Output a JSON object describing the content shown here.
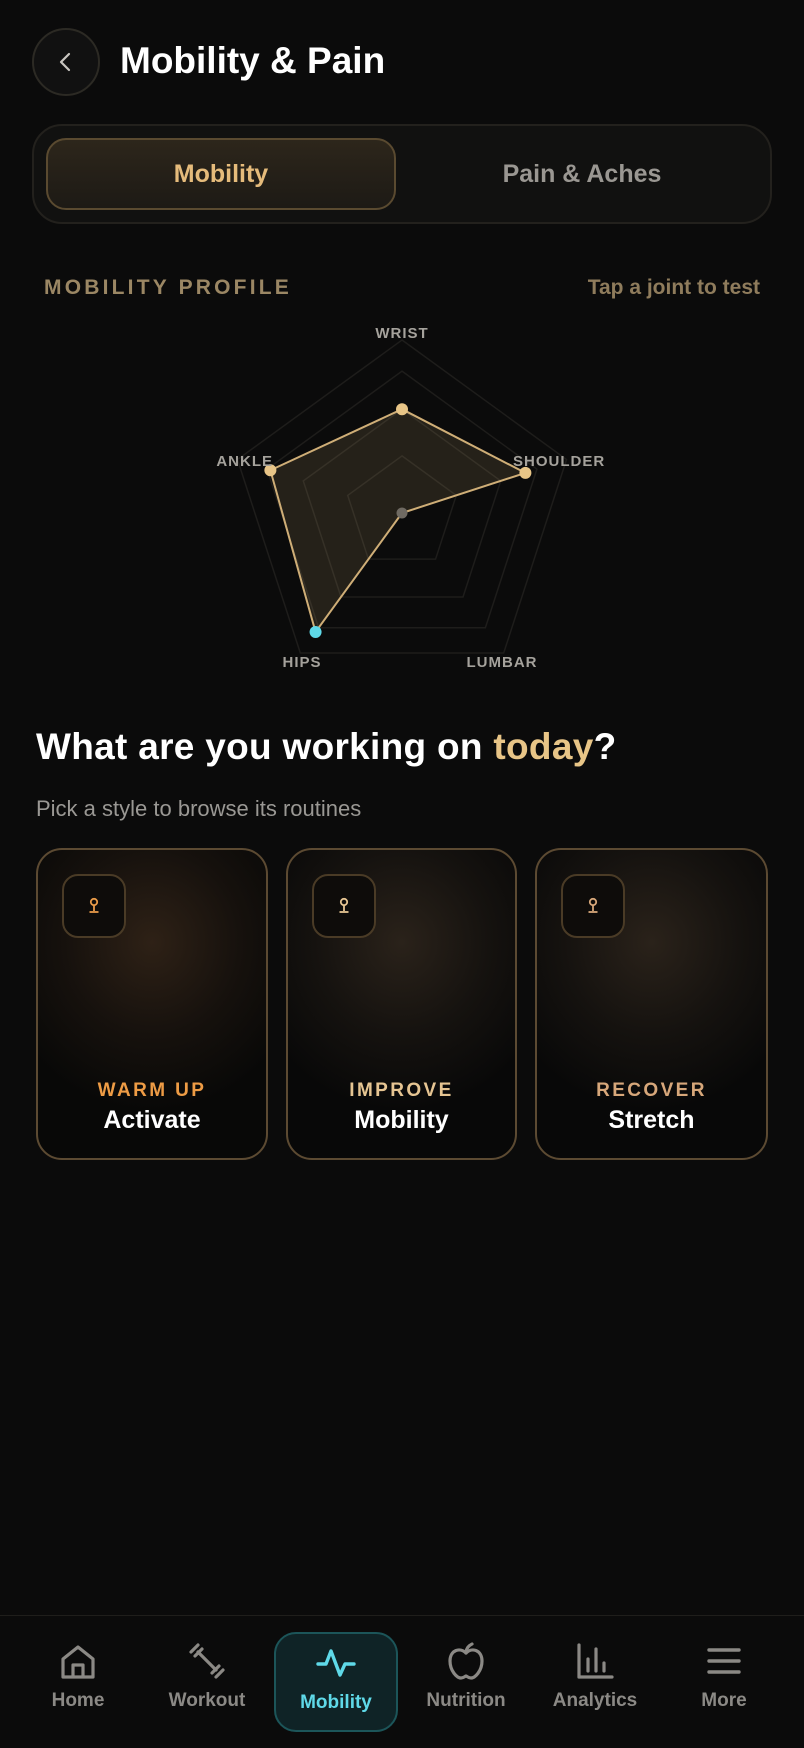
{
  "header": {
    "title": "Mobility & Pain",
    "back_icon": "chevron-left-icon"
  },
  "tabs": [
    {
      "label": "Mobility",
      "active": true
    },
    {
      "label": "Pain & Aches",
      "active": false
    }
  ],
  "profile": {
    "label": "MOBILITY PROFILE",
    "hint": "Tap a joint to test",
    "joints": [
      {
        "name": "WRIST",
        "value": 0.6
      },
      {
        "name": "SHOULDER",
        "value": 0.75
      },
      {
        "name": "LUMBAR",
        "value": 0.0
      },
      {
        "name": "HIPS",
        "value": 0.85
      },
      {
        "name": "ANKLE",
        "value": 0.8
      }
    ],
    "colors": {
      "point": "#e8c587",
      "highlight": "#5fd9e8",
      "empty": "#6f6a62"
    }
  },
  "prompt": {
    "question_start": "What are you working on ",
    "question_accent": "today",
    "question_end": "?",
    "subtitle": "Pick a style to browse its routines"
  },
  "styles": [
    {
      "kicker": "WARM UP",
      "title": "Activate",
      "color": "#ee9c45",
      "icon": "kettlebell-icon"
    },
    {
      "kicker": "IMPROVE",
      "title": "Mobility",
      "color": "#e6c592",
      "icon": "kettlebell-icon"
    },
    {
      "kicker": "RECOVER",
      "title": "Stretch",
      "color": "#d7a77a",
      "icon": "kettlebell-icon"
    }
  ],
  "nav": [
    {
      "label": "Home",
      "icon": "home-icon",
      "active": false
    },
    {
      "label": "Workout",
      "icon": "dumbbell-icon",
      "active": false
    },
    {
      "label": "Mobility",
      "icon": "pulse-icon",
      "active": true
    },
    {
      "label": "Nutrition",
      "icon": "apple-icon",
      "active": false
    },
    {
      "label": "Analytics",
      "icon": "bar-chart-icon",
      "active": false
    },
    {
      "label": "More",
      "icon": "menu-icon",
      "active": false
    }
  ]
}
